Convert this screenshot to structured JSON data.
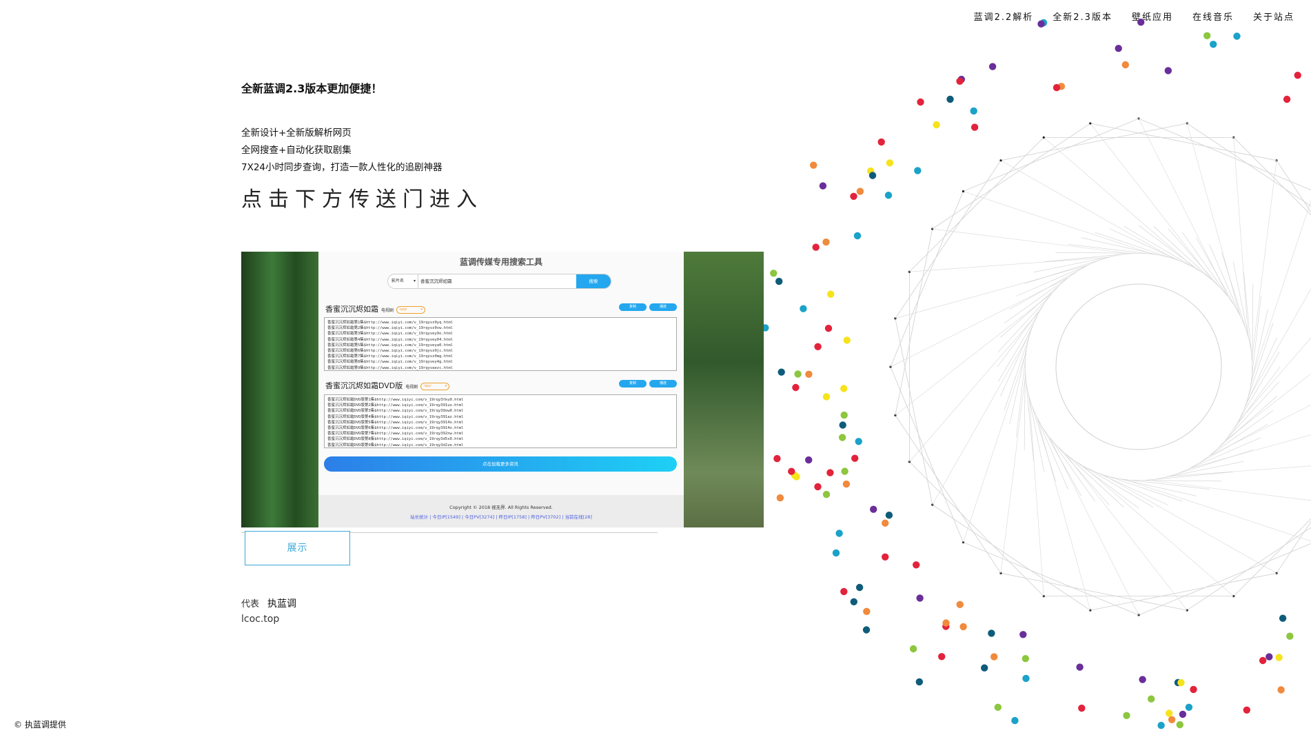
{
  "nav": {
    "items": [
      {
        "label": "蓝调2.2解析"
      },
      {
        "label": "全新2.3版本"
      },
      {
        "label": "壁纸应用"
      },
      {
        "label": "在线音乐"
      },
      {
        "label": "关于站点"
      }
    ]
  },
  "main": {
    "headline": "全新蓝调2.3版本更加便捷！",
    "features": [
      "全新设计+全新版解析网页",
      "全网搜查+自动化获取剧集",
      "7X24小时同步查询，打造一款人性化的追剧神器"
    ],
    "cta": "点击下方传送门进入"
  },
  "preview": {
    "title": "蓝调传媒专用搜索工具",
    "select_label": "影片名",
    "query": "香蜜沉沉烬如霜",
    "search_label": "搜索",
    "blocks": [
      {
        "title": "香蜜沉沉烬如霜",
        "tag": "电视剧",
        "version": "iqiyi",
        "copy_label": "复制",
        "play_label": "播放",
        "lines": [
          "香蜜沉沉烬如霜第1集$http://www.iqiyi.com/v_19rqyvz0yq.html",
          "香蜜沉沉烬如霜第2集$http://www.iqiyi.com/v_19rqyvz0vw.html",
          "香蜜沉沉烬如霜第3集$http://www.iqiyi.com/v_19rqyvey9o.html",
          "香蜜沉沉烬如霜第4集$http://www.iqiyi.com/v_19rqyvey04.html",
          "香蜜沉沉烬如霜第5集$http://www.iqiyi.com/v_19rqyveya0.html",
          "香蜜沉沉烬如霜第6集$http://www.iqiyi.com/v_19rqyvz0jc.html",
          "香蜜沉沉烬如霜第7集$http://www.iqiyi.com/v_19rqyvz0mg.html",
          "香蜜沉沉烬如霜第8集$http://www.iqiyi.com/v_19rqyvey4g.html",
          "香蜜沉沉烬如霜第9集$http://www.iqiyi.com/v_19rqyvaezc.html"
        ]
      },
      {
        "title": "香蜜沉沉烬如霜DVD版",
        "tag": "电视剧",
        "version": "iqiyi",
        "copy_label": "复制",
        "play_label": "播放",
        "lines": [
          "香蜜沉沉烬如霜DVD版第1集$http://www.iqiyi.com/v_19rqy3tku0.html",
          "香蜜沉沉烬如霜DVD版第2集$http://www.iqiyi.com/v_19rqy391uo.html",
          "香蜜沉沉烬如霜DVD版第3集$http://www.iqiyi.com/v_19rqy39ow0.html",
          "香蜜沉沉烬如霜DVD版第4集$http://www.iqiyi.com/v_19rqy391az.html",
          "香蜜沉沉烬如霜DVD版第5集$http://www.iqiyi.com/v_19rqy3914o.html",
          "香蜜沉沉烬如霜DVD版第6集$http://www.iqiyi.com/v_19rqy3914o.html",
          "香蜜沉沉烬如霜DVD版第7集$http://www.iqiyi.com/v_19rqy392nw.html",
          "香蜜沉沉烬如霜DVD版第8集$http://www.iqiyi.com/v_19rqy3d5s0.html",
          "香蜜沉沉烬如霜DVD版第9集$http://www.iqiyi.com/v_19rqy3d2ze.html"
        ]
      }
    ],
    "load_more": "点击加载更多资讯",
    "copyright": "Copyright © 2018 视无界. All Rights Reserved.",
    "stats": "站长统计 | 今日IP[1549] | 今日PV[3274] | 昨日IP[1758] | 昨日PV[3702] | 当前在线[28]"
  },
  "show_button": "展示",
  "representative": {
    "label": "代表",
    "name": "执蓝调"
  },
  "site": "lcoc.top",
  "footer": "© 执蓝调提供",
  "dot_colors": [
    "#e2233b",
    "#f08a3c",
    "#f6e31c",
    "#8dc63f",
    "#1aa2c9",
    "#0e5c7a",
    "#6a2e9a"
  ]
}
